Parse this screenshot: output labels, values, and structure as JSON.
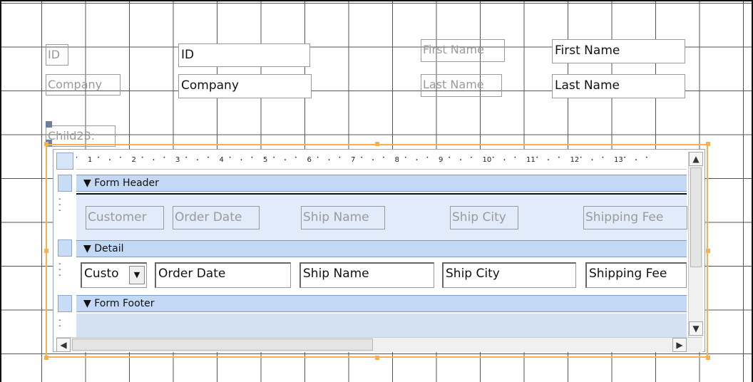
{
  "main_form": {
    "labels": {
      "id": "ID",
      "company": "Company",
      "first_name": "First Name",
      "last_name": "Last Name",
      "child": "Child23:"
    },
    "fields": {
      "id": "ID",
      "company": "Company",
      "first_name": "First Name",
      "last_name": "Last Name"
    }
  },
  "subform": {
    "ruler_ticks": [
      "1",
      "2",
      "3",
      "4",
      "5",
      "6",
      "7",
      "8",
      "9",
      "10",
      "11",
      "12",
      "13"
    ],
    "sections": {
      "header": "Form Header",
      "detail": "Detail",
      "footer": "Form Footer"
    },
    "header_labels": [
      "Customer",
      "Order Date",
      "Ship Name",
      "Ship City",
      "Shipping Fee"
    ],
    "detail_fields": [
      "Custo",
      "Order Date",
      "Ship Name",
      "Ship City",
      "Shipping Fee"
    ]
  },
  "colors": {
    "selection": "#f5b04f",
    "section_bar": "#c2d8f4",
    "grid": "#555555"
  }
}
